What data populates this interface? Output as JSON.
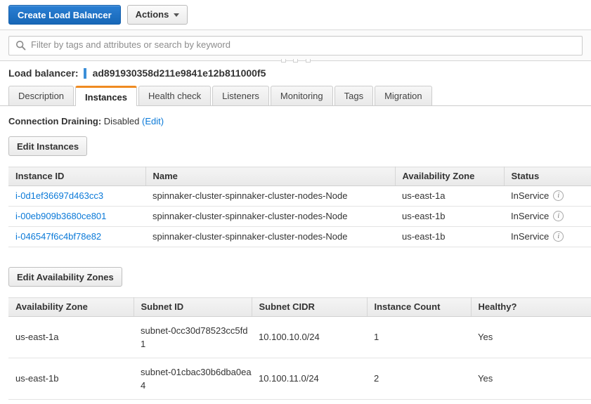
{
  "toolbar": {
    "create_label": "Create Load Balancer",
    "actions_label": "Actions",
    "caret_icon": "chevron-down-icon"
  },
  "filter": {
    "placeholder": "Filter by tags and attributes or search by keyword",
    "value": "",
    "icon": "search-icon"
  },
  "header": {
    "label": "Load balancer:",
    "id": "ad891930358d211e9841e12b811000f5",
    "accent_color": "#3b8fd8"
  },
  "tabs": {
    "active_index": 1,
    "active_border_color": "#ef8b21",
    "items": [
      {
        "label": "Description"
      },
      {
        "label": "Instances"
      },
      {
        "label": "Health check"
      },
      {
        "label": "Listeners"
      },
      {
        "label": "Monitoring"
      },
      {
        "label": "Tags"
      },
      {
        "label": "Migration"
      }
    ]
  },
  "connection_draining": {
    "label": "Connection Draining:",
    "value": "Disabled",
    "edit_link": "(Edit)",
    "link_color": "#0a79d8"
  },
  "instances_section": {
    "button_label": "Edit Instances",
    "columns": [
      "Instance ID",
      "Name",
      "Availability Zone",
      "Status"
    ],
    "rows": [
      {
        "instance_id": "i-0d1ef36697d463cc3",
        "name": "spinnaker-cluster-spinnaker-cluster-nodes-Node",
        "availability_zone": "us-east-1a",
        "status": "InService",
        "info_icon": "info-icon"
      },
      {
        "instance_id": "i-00eb909b3680ce801",
        "name": "spinnaker-cluster-spinnaker-cluster-nodes-Node",
        "availability_zone": "us-east-1b",
        "status": "InService",
        "info_icon": "info-icon"
      },
      {
        "instance_id": "i-046547f6c4bf78e82",
        "name": "spinnaker-cluster-spinnaker-cluster-nodes-Node",
        "availability_zone": "us-east-1b",
        "status": "InService",
        "info_icon": "info-icon"
      }
    ]
  },
  "availability_zones_section": {
    "button_label": "Edit Availability Zones",
    "columns": [
      "Availability Zone",
      "Subnet ID",
      "Subnet CIDR",
      "Instance Count",
      "Healthy?"
    ],
    "rows": [
      {
        "availability_zone": "us-east-1a",
        "subnet_id": "subnet-0cc30d78523cc5fd1",
        "subnet_cidr": "10.100.10.0/24",
        "instance_count": "1",
        "healthy": "Yes"
      },
      {
        "availability_zone": "us-east-1b",
        "subnet_id": "subnet-01cbac30b6dba0ea4",
        "subnet_cidr": "10.100.11.0/24",
        "instance_count": "2",
        "healthy": "Yes"
      }
    ]
  }
}
